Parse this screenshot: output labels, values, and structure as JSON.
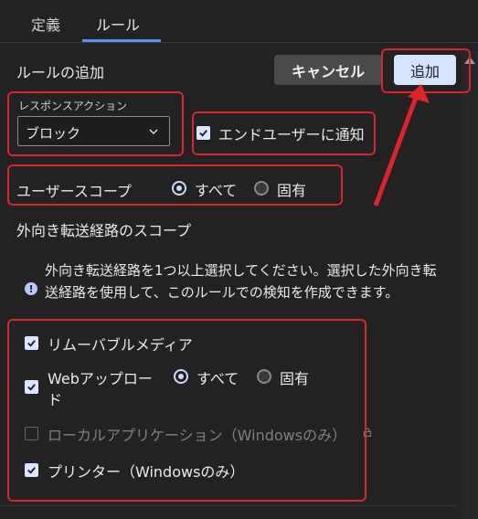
{
  "tabs": [
    {
      "label": "定義"
    },
    {
      "label": "ルール"
    }
  ],
  "page": {
    "heading": "ルールの追加",
    "cancel_label": "キャンセル",
    "add_label": "追加"
  },
  "response_action": {
    "label": "レスポンスアクション",
    "value": "ブロック",
    "notify_label": "エンドユーザーに通知",
    "notify_checked": true
  },
  "user_scope": {
    "label": "ユーザースコープ",
    "options": [
      {
        "label": "すべて",
        "selected": true
      },
      {
        "label": "固有",
        "selected": false
      }
    ]
  },
  "egress_scope": {
    "title": "外向き転送経路のスコープ",
    "info_text": "外向き転送経路を1つ以上選択してください。選択した外向き転送経路を使用して、このルールでの検知を作成できます。",
    "items": [
      {
        "label": "リムーバブルメディア",
        "checked": true,
        "enabled": true
      },
      {
        "label_line1": "Webアップロー",
        "label_line2": "ド",
        "checked": true,
        "enabled": true,
        "options": [
          {
            "label": "すべて",
            "selected": true
          },
          {
            "label": "固有",
            "selected": false
          }
        ]
      },
      {
        "label": "ローカルアプリケーション（Windowsのみ）",
        "checked": false,
        "enabled": false
      },
      {
        "label": "プリンター（Windowsのみ）",
        "checked": true,
        "enabled": true
      }
    ]
  },
  "colors": {
    "highlight": "#e0222a",
    "accent": "#5b8ff5",
    "primary_button": "#d5e3ff"
  }
}
